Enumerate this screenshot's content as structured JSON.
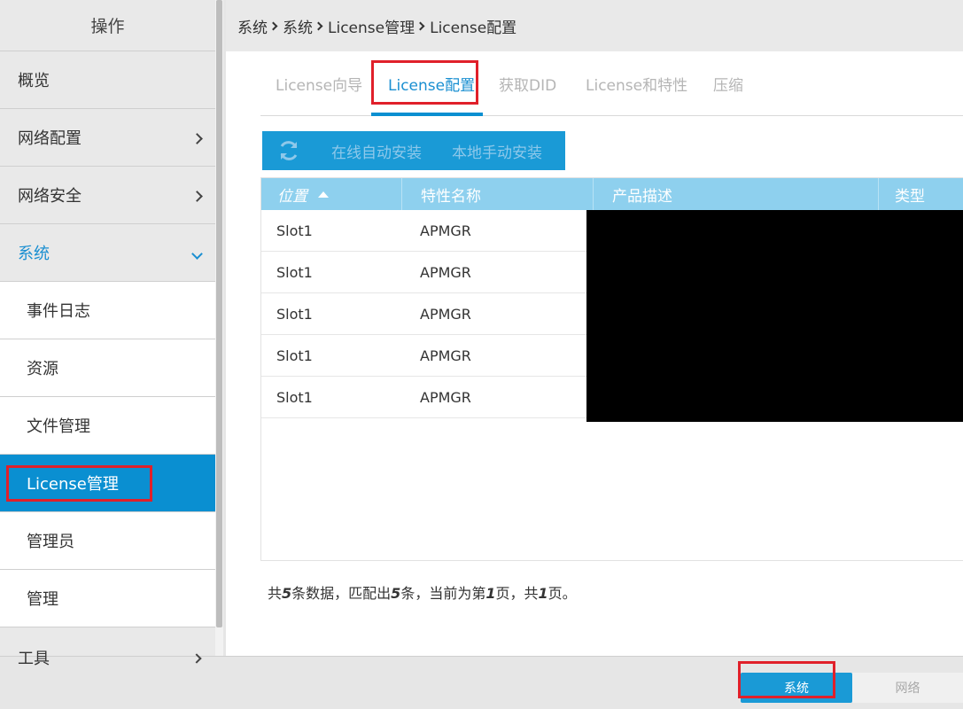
{
  "sidebar": {
    "header": "操作",
    "items": [
      {
        "label": "概览"
      },
      {
        "label": "网络配置"
      },
      {
        "label": "网络安全"
      },
      {
        "label": "系统"
      }
    ],
    "subitems": [
      {
        "label": "事件日志"
      },
      {
        "label": "资源"
      },
      {
        "label": "文件管理"
      },
      {
        "label": "License管理"
      },
      {
        "label": "管理员"
      },
      {
        "label": "管理"
      }
    ],
    "next_item": "工具"
  },
  "breadcrumb": [
    "系统",
    "系统",
    "License管理",
    "License配置"
  ],
  "tabs": [
    {
      "label": "License向导"
    },
    {
      "label": "License配置"
    },
    {
      "label": "获取DID"
    },
    {
      "label": "License和特性"
    },
    {
      "label": "压缩"
    }
  ],
  "toolbar": {
    "refresh_icon": "refresh-icon",
    "online_install": "在线自动安装",
    "local_install": "本地手动安装"
  },
  "table": {
    "columns": [
      "位置",
      "特性名称",
      "产品描述",
      "类型"
    ],
    "rows": [
      {
        "location": "Slot1",
        "feature": "APMGR"
      },
      {
        "location": "Slot1",
        "feature": "APMGR"
      },
      {
        "location": "Slot1",
        "feature": "APMGR"
      },
      {
        "location": "Slot1",
        "feature": "APMGR"
      },
      {
        "location": "Slot1",
        "feature": "APMGR"
      }
    ]
  },
  "summary": {
    "p1": "共",
    "total": "5",
    "p2": "条数据，匹配出",
    "matched": "5",
    "p3": "条，当前为第",
    "page": "1",
    "p4": "页，共",
    "pages": "1",
    "p5": "页。"
  },
  "bottom": {
    "system": "系统",
    "network": "网络"
  },
  "colors": {
    "accent": "#0a8fd1",
    "highlight_box": "#e0202a",
    "table_header": "#8ed0ee"
  }
}
